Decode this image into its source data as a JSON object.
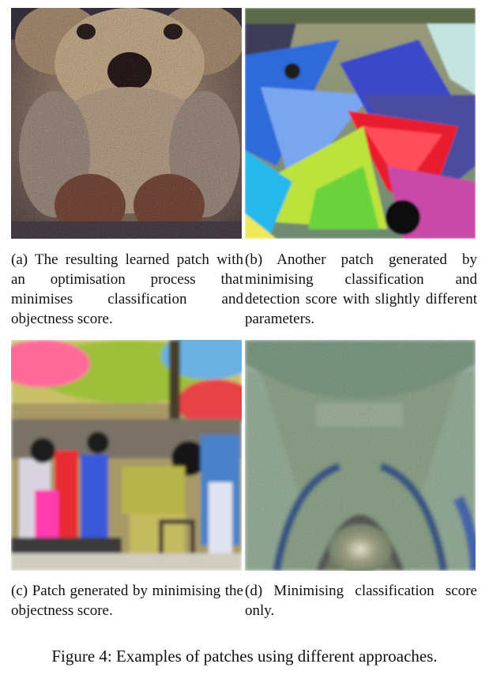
{
  "figure": {
    "subfigures": [
      {
        "label": "(a)",
        "caption": "(a) The resulting learned patch with an optimisation process that minimises classification and objectness score."
      },
      {
        "label": "(b)",
        "caption": "(b) Another patch generated by minimising classification and detection score with slightly different parameters."
      },
      {
        "label": "(c)",
        "caption": "(c) Patch generated by minimis­ing the objectness score."
      },
      {
        "label": "(d)",
        "caption": "(d) Minimising classification score only."
      }
    ],
    "caption": "Figure 4: Examples of patches using different approaches."
  }
}
